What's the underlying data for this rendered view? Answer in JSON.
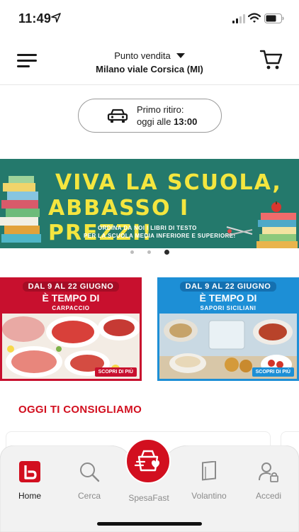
{
  "status_bar": {
    "time": "11:49",
    "icons": [
      "location-arrow-icon",
      "cellular-signal-icon",
      "wifi-icon",
      "battery-icon"
    ]
  },
  "header": {
    "store_caption": "Punto vendita",
    "store_name": "Milano viale Corsica (MI)",
    "menu_icon": "hamburger-menu-icon",
    "cart_icon": "shopping-cart-icon"
  },
  "pickup": {
    "label": "Primo ritiro:",
    "prefix": "oggi alle ",
    "time": "13:00",
    "icon": "car-icon"
  },
  "banner": {
    "title_line1": "VIVA LA SCUOLA,",
    "title_line2": "ABBASSO I PREZZI!",
    "subtitle_line1": "ORDINA DA NOI I LIBRI DI TESTO",
    "subtitle_line2": "PER LA SCUOLA MEDIA INFERIORE E SUPERIORE!",
    "slides_total": 3,
    "active_slide": 3
  },
  "promos": [
    {
      "dates": "DAL 9 AL 22 GIUGNO",
      "headline": "È TEMPO DI",
      "tag": "CARPACCIO",
      "cta": "SCOPRI DI PIÙ",
      "color": "#c8102e"
    },
    {
      "dates": "DAL 9 AL 22 GIUGNO",
      "headline": "È TEMPO DI",
      "tag": "SAPORI SICILIANI",
      "cta": "SCOPRI DI PIÙ",
      "color": "#1d8fd6"
    }
  ],
  "section": {
    "title": "OGGI TI CONSIGLIAMO"
  },
  "tabbar": {
    "tabs": [
      {
        "label": "Home",
        "icon": "home-logo-icon",
        "active": true
      },
      {
        "label": "Cerca",
        "icon": "search-icon",
        "active": false
      },
      {
        "label": "SpesaFast",
        "icon": "shopping-basket-heart-icon",
        "active": false
      },
      {
        "label": "Volantino",
        "icon": "flyer-icon",
        "active": false
      },
      {
        "label": "Accedi",
        "icon": "user-lock-icon",
        "active": false
      }
    ]
  },
  "colors": {
    "brand_red": "#d20f1f",
    "banner_green": "#24796c",
    "banner_yellow": "#f4e63f",
    "promo_blue": "#1d8fd6"
  }
}
